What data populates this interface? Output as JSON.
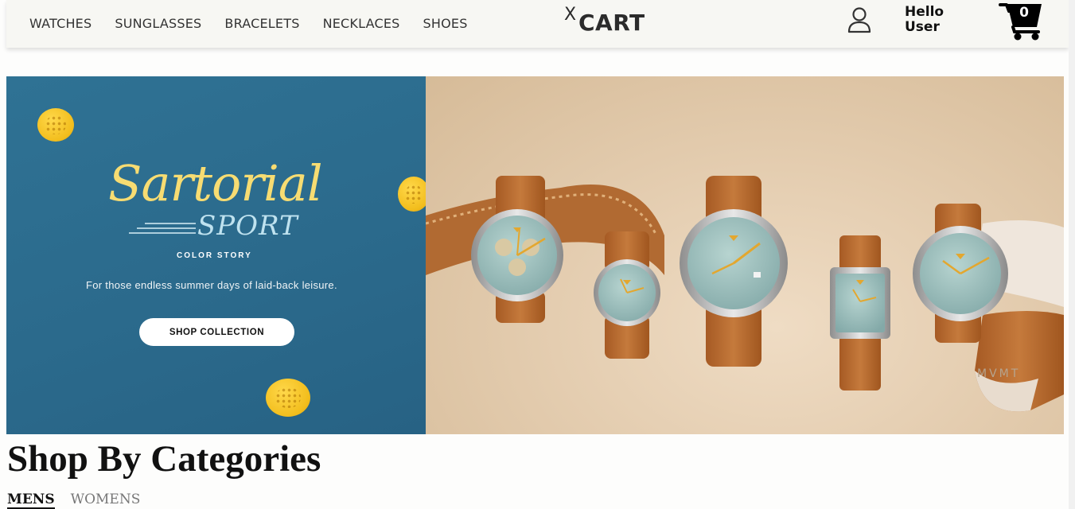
{
  "nav": {
    "items": [
      "WATCHES",
      "SUNGLASSES",
      "BRACELETS",
      "NECKLACES",
      "SHOES"
    ]
  },
  "logo": {
    "prefix": "X",
    "name": "CART"
  },
  "user": {
    "greeting_line1": "Hello",
    "greeting_line2": "User"
  },
  "cart": {
    "count": "0"
  },
  "banner": {
    "headline": "Sartorial",
    "subheadline": "SPORT",
    "kicker": "COLOR STORY",
    "tagline": "For those endless summer days of laid-back leisure.",
    "cta_label": "SHOP COLLECTION",
    "strap_imprint": "MVMT",
    "colors": {
      "left_bg": "#2b6a8c",
      "headline": "#f7dc72",
      "subheadline": "#bfe2ef",
      "strap": "#b86a30",
      "dial": "#9bbfbd"
    }
  },
  "categories": {
    "title": "Shop By Categories",
    "tabs": [
      {
        "label": "MENS",
        "active": true
      },
      {
        "label": "WOMENS",
        "active": false
      }
    ]
  }
}
